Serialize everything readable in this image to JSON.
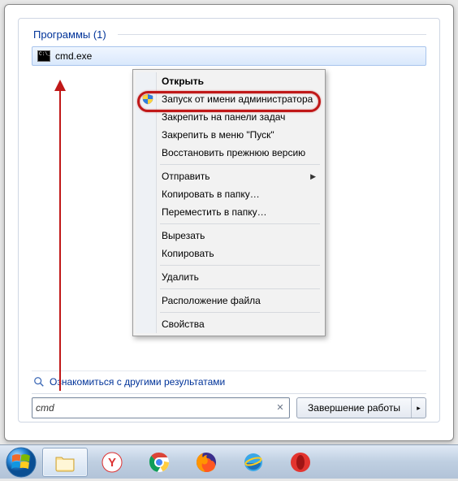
{
  "section": {
    "title": "Программы (1)"
  },
  "result": {
    "label": "cmd.exe"
  },
  "context_menu": {
    "open": "Открыть",
    "run_as_admin": "Запуск от имени администратора",
    "pin_taskbar": "Закрепить на панели задач",
    "pin_start": "Закрепить в меню \"Пуск\"",
    "restore_prev": "Восстановить прежнюю версию",
    "send_to": "Отправить",
    "copy_to_folder": "Копировать в папку…",
    "move_to_folder": "Переместить в папку…",
    "cut": "Вырезать",
    "copy": "Копировать",
    "delete": "Удалить",
    "file_location": "Расположение файла",
    "properties": "Свойства"
  },
  "see_more": "Ознакомиться с другими результатами",
  "search": {
    "value": "cmd"
  },
  "shutdown": {
    "label": "Завершение работы"
  }
}
